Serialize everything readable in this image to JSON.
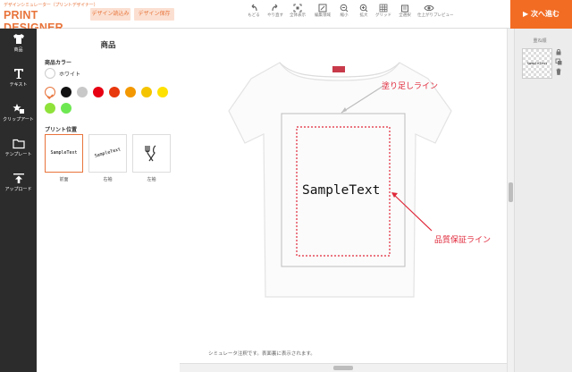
{
  "header": {
    "logo_sub": "デザインシミュレーター（プリントデザイナー）",
    "logo_main": "PRINT DESIGNER",
    "load_button": "デザイン読込み",
    "save_button": "デザイン保存",
    "tools": [
      {
        "icon": "undo-icon",
        "label": "もどる"
      },
      {
        "icon": "redo-icon",
        "label": "やり直す"
      },
      {
        "icon": "fit-all-icon",
        "label": "全体表示"
      },
      {
        "icon": "edit-area-icon",
        "label": "編集領域"
      },
      {
        "icon": "zoom-out-icon",
        "label": "縮小"
      },
      {
        "icon": "zoom-in-icon",
        "label": "拡大"
      },
      {
        "icon": "grid-icon",
        "label": "グリッド"
      },
      {
        "icon": "delete-all-icon",
        "label": "全選択"
      },
      {
        "icon": "preview-icon",
        "label": "仕上がりプレビュー"
      }
    ],
    "next_button": "▶ 次へ進む"
  },
  "sidebar": {
    "items": [
      {
        "icon": "tshirt-icon",
        "label": "商品"
      },
      {
        "icon": "text-icon",
        "label": "テキスト"
      },
      {
        "icon": "clipart-icon",
        "label": "クリップアート"
      },
      {
        "icon": "template-folder-icon",
        "label": "テンプレート"
      },
      {
        "icon": "upload-icon",
        "label": "アップロード"
      }
    ]
  },
  "panel": {
    "title": "商品",
    "color_label": "商品カラー",
    "current_color": "ホワイト",
    "swatches": [
      "#ffffff",
      "#111111",
      "#c8c8c8",
      "#e60012",
      "#e8380d",
      "#f39800",
      "#f5c400",
      "#ffe100",
      "#8fe23a",
      "#6ee852"
    ],
    "print_position_label": "プリント位置",
    "views": [
      {
        "label": "前面",
        "sample": "SampleText",
        "selected": true
      },
      {
        "label": "右袖",
        "sample": "SampleText",
        "selected": false
      },
      {
        "label": "左袖",
        "sample": "",
        "selected": false
      }
    ]
  },
  "canvas": {
    "sample_text": "SampleText",
    "bleed_label": "塗り足しライン",
    "quality_label": "品質保証ライン",
    "note": "シミュレータ注釈です。表面裏に表示されます。"
  },
  "layers": {
    "title": "重ね順",
    "item_text": "SampleText"
  },
  "colors": {
    "accent": "#f26c24",
    "annotation": "#e0283a",
    "sidebar_bg": "#2c2c2c"
  }
}
